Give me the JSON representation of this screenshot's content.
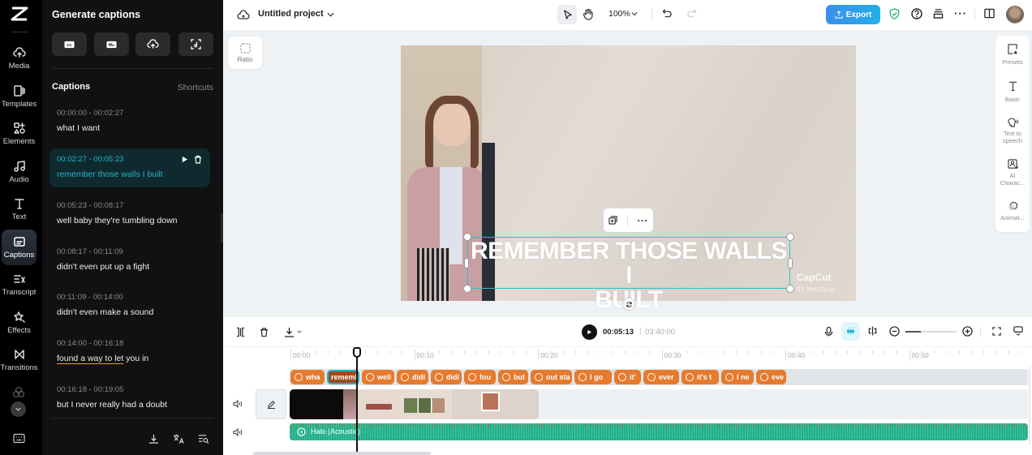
{
  "app": {
    "brand_icon": "capcut-logo-icon"
  },
  "rail": {
    "items": [
      {
        "label": "Media",
        "icon": "cloud-upload-icon"
      },
      {
        "label": "Templates",
        "icon": "templates-icon"
      },
      {
        "label": "Elements",
        "icon": "elements-icon"
      },
      {
        "label": "Audio",
        "icon": "music-note-icon"
      },
      {
        "label": "Text",
        "icon": "text-icon"
      },
      {
        "label": "Captions",
        "icon": "captions-icon",
        "active": true
      },
      {
        "label": "Transcript",
        "icon": "transcript-icon"
      },
      {
        "label": "Effects",
        "icon": "effects-icon"
      },
      {
        "label": "Transitions",
        "icon": "transitions-icon"
      }
    ]
  },
  "panel": {
    "title": "Generate captions",
    "gen_buttons": [
      "cc-auto-captions-icon",
      "subtitle-icon",
      "upload-captions-icon",
      "scan-lyrics-icon"
    ],
    "captions_heading": "Captions",
    "shortcuts_label": "Shortcuts",
    "captions": [
      {
        "time": "00:00:00 - 00:02:27",
        "text": "what I want"
      },
      {
        "time": "00:02:27 - 00:05:23",
        "text": "remember those walls I built",
        "active": true
      },
      {
        "time": "00:05:23 - 00:08:17",
        "text": "well baby they're tumbling down"
      },
      {
        "time": "00:08:17 - 00:11:09",
        "text": "didn't even put up a fight"
      },
      {
        "time": "00:11:09 - 00:14:00",
        "text": "didn't even make a sound"
      },
      {
        "time": "00:14:00 - 00:16:18",
        "text_underlined": "found a way to let",
        "text_rest": " you in"
      },
      {
        "time": "00:16:18 - 00:19:05",
        "text": "but I never really had a doubt"
      }
    ],
    "footer_icons": [
      "download-icon",
      "translate-icon",
      "search-list-icon"
    ]
  },
  "topbar": {
    "project_name": "Untitled project",
    "zoom": "100%",
    "export_label": "Export"
  },
  "stage": {
    "ratio_label": "Ratio",
    "caption_line1": "REMEMBER THOSE WALLS I",
    "caption_line2": "BUILT",
    "watermark": "CapCut",
    "watermark_id": "ID: MasOpap"
  },
  "right_panel": {
    "items": [
      {
        "label": "Presets"
      },
      {
        "label": "Basic"
      },
      {
        "label": "Text to speech"
      },
      {
        "label": "AI Charac..."
      },
      {
        "label": "Animat..."
      }
    ]
  },
  "toolbar": {
    "current_time": "00:05:13",
    "total_time": "03:40:00",
    "zoom_level": 0.3
  },
  "timeline": {
    "ticks": [
      "00:00",
      "00:10",
      "00:20",
      "00:30",
      "00:40",
      "00:50"
    ],
    "caption_chips": [
      "wha",
      "rememl",
      "well",
      "didi",
      "didi",
      "fou",
      "but",
      "out sta",
      "I go",
      "it'",
      "ever",
      "it's t",
      "I ne",
      "eve"
    ],
    "audio_track_label": "Halo (Acoustic)",
    "playhead_time": "00:05:13"
  },
  "colors": {
    "accent": "#21b4c8",
    "chip": "#e67a2d",
    "audio": "#1fb08a",
    "export": "#2fa3ea"
  }
}
